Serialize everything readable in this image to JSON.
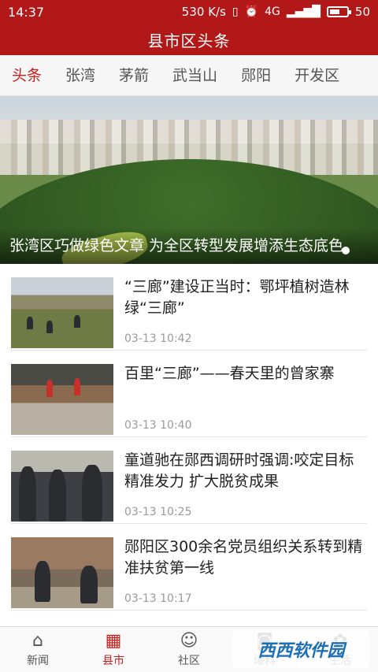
{
  "status_bar": {
    "time": "14:37",
    "speed": "530 K/s",
    "network": "4G",
    "battery": "50"
  },
  "header": {
    "title": "县市区头条"
  },
  "tabs": [
    {
      "label": "头条",
      "active": true
    },
    {
      "label": "张湾",
      "active": false
    },
    {
      "label": "茅箭",
      "active": false
    },
    {
      "label": "武当山",
      "active": false
    },
    {
      "label": "郧阳",
      "active": false
    },
    {
      "label": "开发区",
      "active": false
    }
  ],
  "hero": {
    "caption": "张湾区巧做绿色文章 为全区转型发展增添生态底色"
  },
  "news": [
    {
      "title": "“三廊”建设正当时：鄂坪植树造林绿“三廊”",
      "time": "03-13 10:42"
    },
    {
      "title": "百里“三廊”——春天里的曾家寨",
      "time": "03-13 10:40"
    },
    {
      "title": "童道驰在郧西调研时强调:咬定目标精准发力 扩大脱贫成果",
      "time": "03-13 10:25"
    },
    {
      "title": "郧阳区300余名党员组织关系转到精准扶贫第一线",
      "time": "03-13 10:17"
    }
  ],
  "bottom_nav": [
    {
      "label": "新闻",
      "icon": "home-icon",
      "active": false
    },
    {
      "label": "县市",
      "icon": "building-icon",
      "active": true
    },
    {
      "label": "社区",
      "icon": "chat-icon",
      "active": false
    },
    {
      "label": "爆料",
      "icon": "camera-icon",
      "active": false
    },
    {
      "label": "生活",
      "icon": "life-icon",
      "active": false
    }
  ],
  "watermark": {
    "text": "西西软件园"
  },
  "colors": {
    "brand_red": "#b31818",
    "active_red": "#c81e1e",
    "time_gray": "#9a9a9a"
  }
}
